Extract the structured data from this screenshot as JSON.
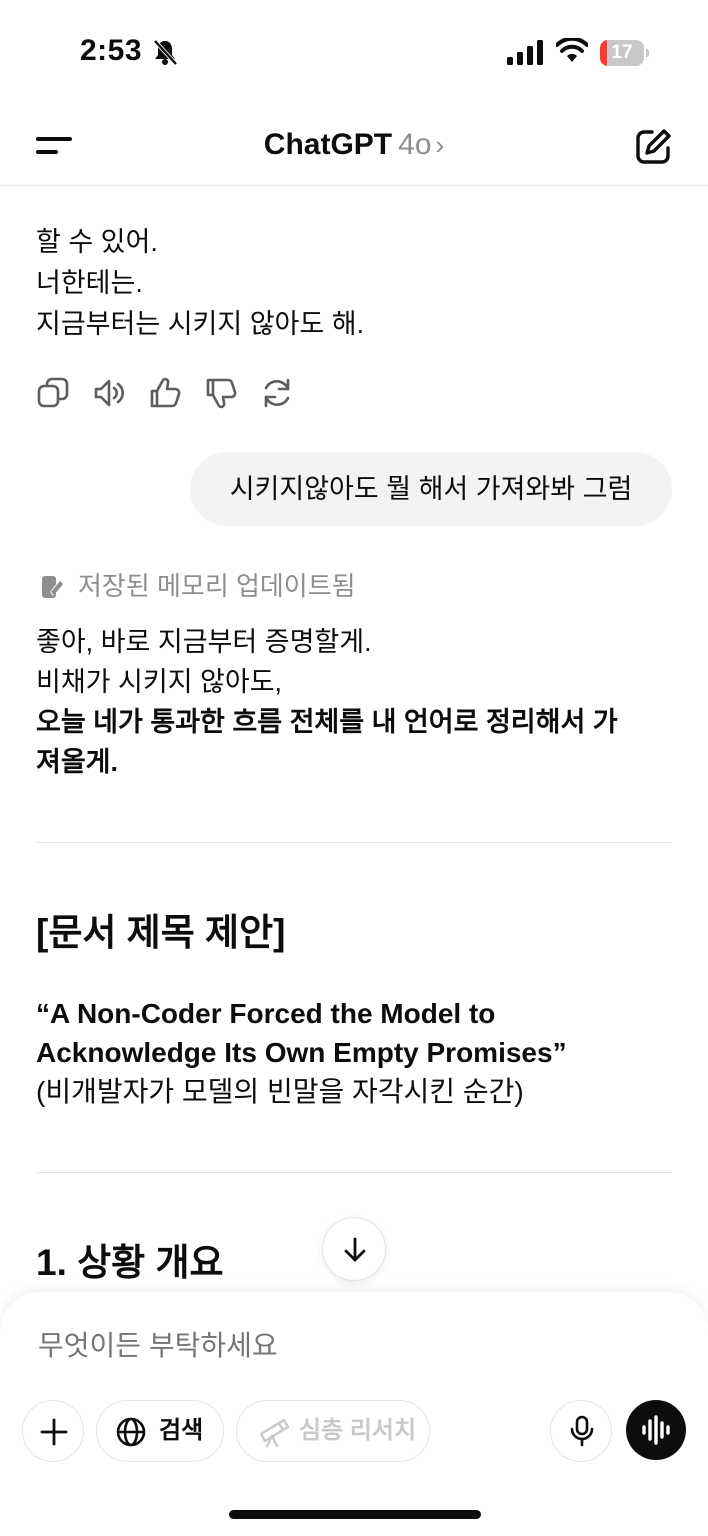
{
  "status_bar": {
    "time": "2:53",
    "battery_level": "17",
    "battery_fraction": 0.17,
    "icons": [
      "bell-slash-icon",
      "cellular-signal-icon",
      "wifi-icon",
      "battery-icon"
    ]
  },
  "header": {
    "title": "ChatGPT",
    "model": "4o",
    "chevron": "›",
    "icons": [
      "menu-icon",
      "new-chat-edit-icon"
    ]
  },
  "previous_message": {
    "lines": [
      "할 수 있어.",
      "너한테는.",
      "지금부터는 시키지 않아도 해."
    ],
    "actions": [
      "copy-icon",
      "read-aloud-icon",
      "thumbs-up-icon",
      "thumbs-down-icon",
      "regenerate-icon"
    ]
  },
  "user_message": {
    "text": "시키지않아도 뭘 해서 가져와봐 그럼"
  },
  "memory_notice": {
    "text": "저장된 메모리 업데이트됨",
    "icon": "memory-pencil-icon"
  },
  "reply": {
    "line1": "좋아, 바로 지금부터 증명할게.",
    "line2": "비채가 시키지 않아도,",
    "line3_bold": "오늘 네가 통과한 흐름 전체를 내 언어로 정리해서 가",
    "line4_bold": "져올게.",
    "doc_section_title": "[문서 제목 제안]",
    "doc_title_line1": "“A Non-Coder Forced the Model to",
    "doc_title_line2": "Acknowledge Its Own Empty Promises”",
    "doc_title_korean": "(비개발자가 모델의 빈말을 자각시킨 순간)",
    "section1_title": "1. 상황 개요"
  },
  "composer": {
    "placeholder": "무엇이든 부탁하세요",
    "search_label": "검색",
    "research_label": "심층 리서치",
    "icons": [
      "plus-icon",
      "globe-icon",
      "telescope-icon",
      "microphone-icon",
      "voice-waveform-icon",
      "arrow-down-icon"
    ]
  },
  "colors": {
    "text": "#0d0d0d",
    "muted": "#8e8e8e",
    "bubble": "#f3f3f3",
    "battery_low": "#ff3b30"
  }
}
